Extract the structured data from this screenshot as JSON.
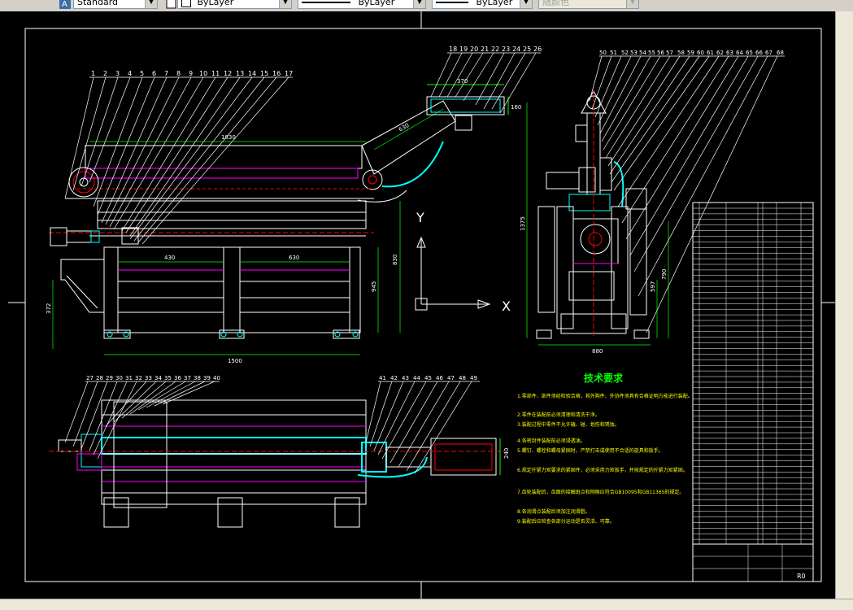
{
  "toolbar": {
    "text_style": "Standard",
    "layer": "ByLayer",
    "linetype": "ByLayer",
    "lineweight": "ByLayer",
    "plot_style": "随颜色"
  },
  "drawing": {
    "title": "技术要求",
    "leaders_top_left": [
      "1",
      "2",
      "3",
      "4",
      "5",
      "6",
      "7",
      "8",
      "9",
      "10",
      "11",
      "12",
      "13",
      "14",
      "15",
      "16",
      "17"
    ],
    "leaders_top_mid": [
      "18",
      "19",
      "20",
      "21",
      "22",
      "23",
      "24",
      "25",
      "26"
    ],
    "leaders_right": [
      "50",
      "51",
      "52",
      "53",
      "54",
      "55",
      "56",
      "57",
      "58",
      "59",
      "60",
      "61",
      "62",
      "63",
      "64",
      "65",
      "66",
      "67",
      "68"
    ],
    "leaders_bottom_left": [
      "27",
      "28",
      "29",
      "30",
      "31",
      "32",
      "33",
      "34",
      "35",
      "36",
      "37",
      "38",
      "39",
      "40"
    ],
    "leaders_bottom_mid": [
      "41",
      "42",
      "43",
      "44",
      "45",
      "46",
      "47",
      "48",
      "49"
    ],
    "dimensions": {
      "d1830": "1830",
      "d630": "630",
      "d370": "370",
      "d160": "160",
      "d430": "430",
      "d630b": "630",
      "d830": "830",
      "d945": "945",
      "d372": "372",
      "d1500": "1500",
      "d1375": "1375",
      "d597": "597",
      "d790": "790",
      "d880": "880",
      "d240": "240"
    },
    "axis_y": "Y",
    "axis_x": "X",
    "title_block_code": "R0",
    "tech_notes": [
      "1.零部件、部件须经检验合格，其外购件、外协件须具有合格证明方能进行装配。",
      "2.零件在装配前必须清理和清洗干净。",
      "3.装配过程中零件不允许磕、碰、划伤和锈蚀。",
      "4.各密封件装配前必须浸透油。",
      "5.螺钉、螺栓和螺母紧固时，严禁打击或使用不合适的旋具和扳手。",
      "6.规定拧紧力矩要求的紧固件，必须采用力矩扳手，并按规定的拧紧力矩紧固。",
      "7.齿轮装配后，齿面的接触斑点和侧隙应符合GB10095和GB11365的规定。",
      "8.各润滑点装配后须加注润滑脂。",
      "9.装配后应检查各部分运动是否灵活、可靠。"
    ]
  }
}
